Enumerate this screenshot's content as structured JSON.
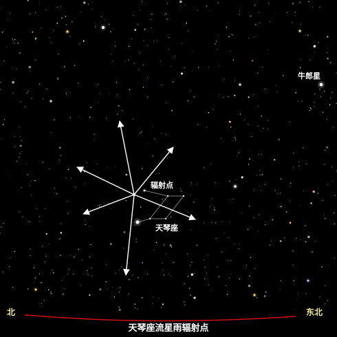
{
  "labels": {
    "altair": "牛郎星",
    "radiant": "辐射点",
    "lyra": "天琴座",
    "north": "北",
    "northeast": "东北",
    "caption": "天琴座流星雨辐射点"
  },
  "colors": {
    "background": "#000000",
    "arrow": "#ffffff",
    "horizon": "#d01010",
    "compass_text": "#f0e6a8",
    "constellation_line": "#9aa0a8"
  }
}
